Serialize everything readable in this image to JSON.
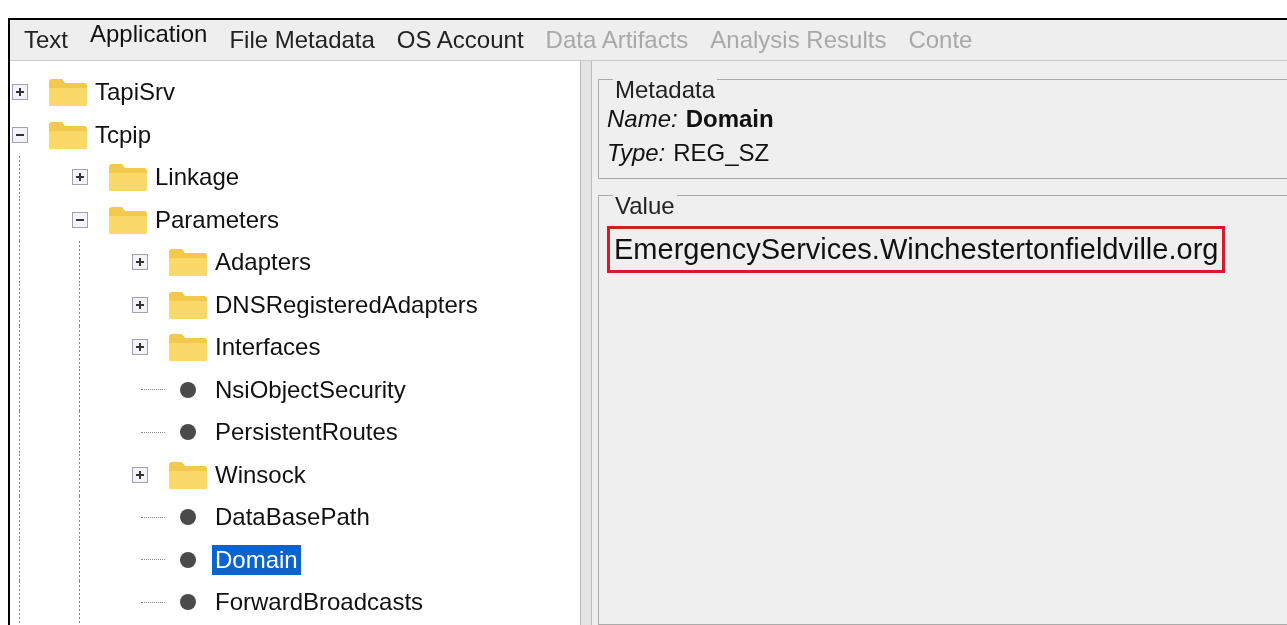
{
  "tabs": [
    {
      "label": "Text",
      "selected": false,
      "disabled": false
    },
    {
      "label": "Application",
      "selected": true,
      "disabled": false
    },
    {
      "label": "File Metadata",
      "selected": false,
      "disabled": false
    },
    {
      "label": "OS Account",
      "selected": false,
      "disabled": false
    },
    {
      "label": "Data Artifacts",
      "selected": false,
      "disabled": true
    },
    {
      "label": "Analysis Results",
      "selected": false,
      "disabled": true
    },
    {
      "label": "Conte",
      "selected": false,
      "disabled": true
    }
  ],
  "tree": [
    {
      "label": "TapiSrv",
      "kind": "folder",
      "expanded": false,
      "selected": false
    },
    {
      "label": "Tcpip",
      "kind": "folder",
      "expanded": true,
      "selected": false,
      "children": [
        {
          "label": "Linkage",
          "kind": "folder",
          "expanded": false,
          "selected": false
        },
        {
          "label": "Parameters",
          "kind": "folder",
          "expanded": true,
          "selected": false,
          "children": [
            {
              "label": "Adapters",
              "kind": "folder",
              "expanded": false,
              "selected": false
            },
            {
              "label": "DNSRegisteredAdapters",
              "kind": "folder",
              "expanded": false,
              "selected": false
            },
            {
              "label": "Interfaces",
              "kind": "folder",
              "expanded": false,
              "selected": false
            },
            {
              "label": "NsiObjectSecurity",
              "kind": "value",
              "selected": false
            },
            {
              "label": "PersistentRoutes",
              "kind": "value",
              "selected": false
            },
            {
              "label": "Winsock",
              "kind": "folder",
              "expanded": false,
              "selected": false
            },
            {
              "label": "DataBasePath",
              "kind": "value",
              "selected": false
            },
            {
              "label": "Domain",
              "kind": "value",
              "selected": true
            },
            {
              "label": "ForwardBroadcasts",
              "kind": "value",
              "selected": false
            }
          ]
        }
      ]
    }
  ],
  "metadata": {
    "title": "Metadata",
    "name_label": "Name:",
    "name_value": "Domain",
    "type_label": "Type:",
    "type_value": "REG_SZ"
  },
  "value": {
    "title": "Value",
    "text": "EmergencyServices.Winchestertonfieldville.org",
    "highlighted": true
  }
}
